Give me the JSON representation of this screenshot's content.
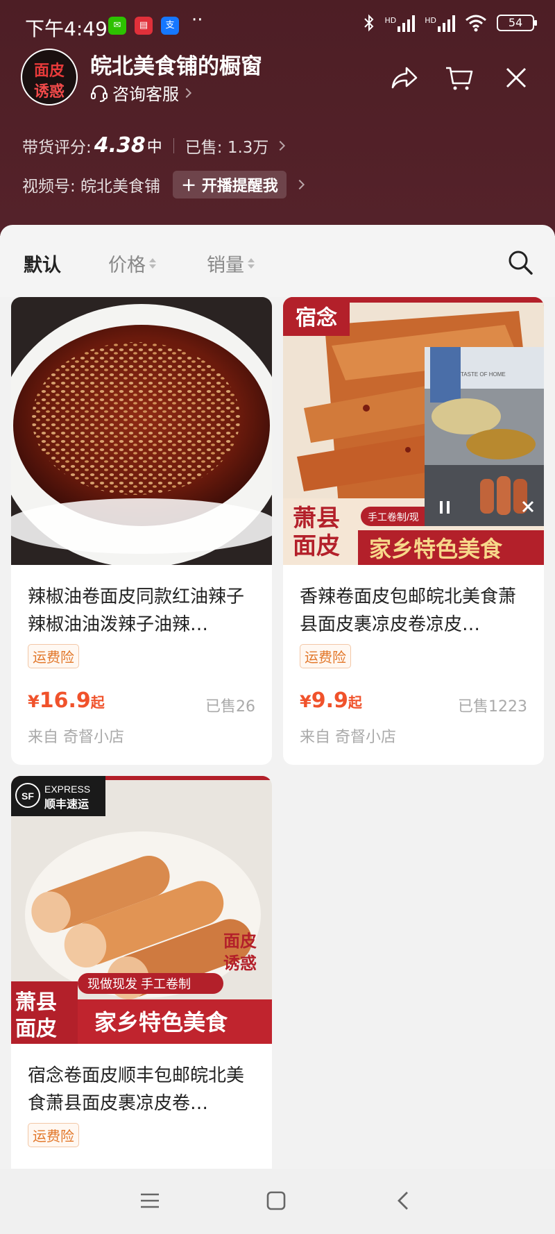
{
  "status_bar": {
    "time": "下午4:49",
    "battery": "54",
    "hd1": "HD",
    "hd2": "HD"
  },
  "shop": {
    "logo_text_line1": "面皮",
    "logo_text_line2": "诱惑",
    "name": "皖北美食铺的橱窗",
    "service_label": "咨询客服",
    "rating_label": "带货评分:",
    "rating_value": "4.38",
    "rating_grade": "中",
    "sold_label": "已售: 1.3万",
    "channel_label": "视频号: 皖北美食铺",
    "remind_button": "开播提醒我"
  },
  "sort_tabs": [
    {
      "label": "默认",
      "active": true
    },
    {
      "label": "价格",
      "active": false
    },
    {
      "label": "销量",
      "active": false
    }
  ],
  "products": [
    {
      "title": "辣椒油卷面皮同款红油辣子辣椒油油泼辣子油辣…",
      "badge": "运费险",
      "price_currency": "¥",
      "price": "16.9",
      "price_suffix": "起",
      "sold": "已售26",
      "from": "来自 奇督小店"
    },
    {
      "title": "香辣卷面皮包邮皖北美食萧县面皮裹凉皮卷凉皮…",
      "badge": "运费险",
      "price_currency": "¥",
      "price": "9.9",
      "price_suffix": "起",
      "sold": "已售1223",
      "from": "来自 奇督小店",
      "image_text": {
        "brand": "宿念",
        "handmade": "手工卷制/现",
        "region_line1": "萧县",
        "region_line2": "面皮",
        "slogan": "家乡特色美食",
        "sign": "TASTE OF HOME"
      }
    },
    {
      "title": "宿念卷面皮顺丰包邮皖北美食萧县面皮裹凉皮卷…",
      "badge": "运费险",
      "image_text": {
        "express_en": "EXPRESS",
        "express_cn": "顺丰速运",
        "sf": "SF",
        "region_line1": "萧县",
        "region_line2": "面皮",
        "banner": "现做现发 手工卷制",
        "slogan": "家乡特色美食",
        "tag_line1": "面皮",
        "tag_line2": "诱惑"
      }
    }
  ],
  "colors": {
    "header_bg": "#4d1e25",
    "price": "#f0522b",
    "badge": "#e2772a",
    "banner_red": "#b3202a"
  }
}
